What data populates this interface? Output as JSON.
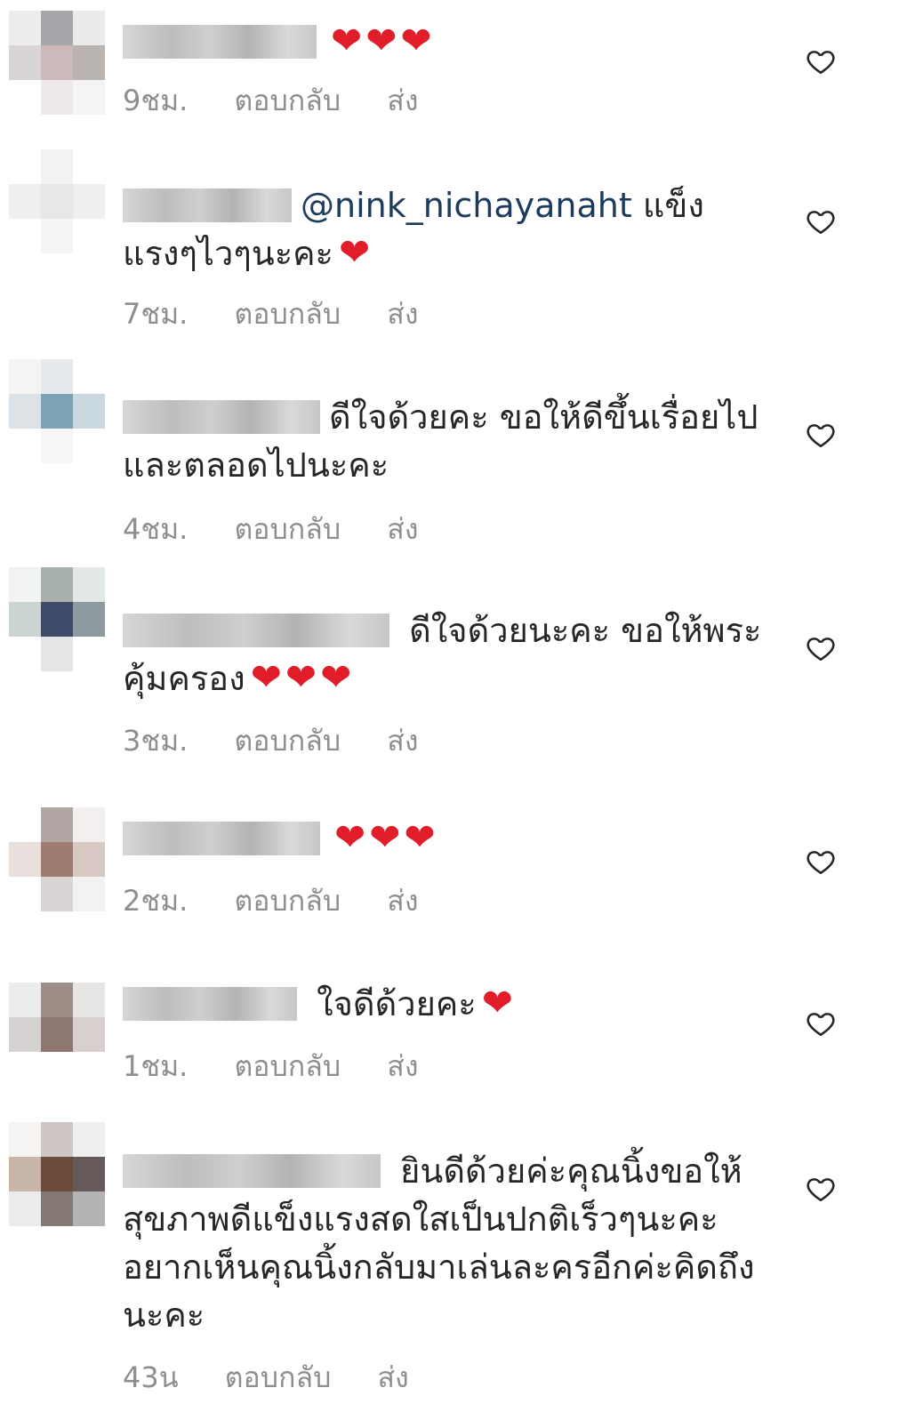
{
  "comments": [
    {
      "text": "",
      "hearts": "❤❤❤",
      "time": "9ชม.",
      "reply": "ตอบกลับ",
      "send": "ส่ง"
    },
    {
      "mention": "@nink_nichayanaht",
      "text": " แข็งแรงๆไวๆนะคะ",
      "hearts": "❤",
      "time": "7ชม.",
      "reply": "ตอบกลับ",
      "send": "ส่ง"
    },
    {
      "text": "ดีใจด้วยคะ ขอให้ดีขึ้นเรื่อยไปและตลอดไปนะคะ",
      "hearts": "",
      "time": "4ชม.",
      "reply": "ตอบกลับ",
      "send": "ส่ง"
    },
    {
      "text": " ดีใจด้วยนะคะ ขอให้พระคุ้มครอง",
      "hearts": "❤❤❤",
      "time": "3ชม.",
      "reply": "ตอบกลับ",
      "send": "ส่ง"
    },
    {
      "text": "",
      "hearts": "❤❤❤",
      "time": "2ชม.",
      "reply": "ตอบกลับ",
      "send": "ส่ง"
    },
    {
      "text": " ใจดีด้วยคะ",
      "hearts": "❤",
      "time": "1ชม.",
      "reply": "ตอบกลับ",
      "send": "ส่ง"
    },
    {
      "text": " ยินดีด้วยค่ะคุณนิ้งขอให้สุขภาพดีแข็งแรงสดใสเป็นปกติเร็วๆนะคะอยากเห็นคุณนิ้งกลับมาเล่นละครอีกค่ะคิดถึงนะคะ",
      "hearts": "",
      "time": "43น",
      "reply": "ตอบกลับ",
      "send": "ส่ง"
    }
  ],
  "colors": {
    "text": "#262626",
    "meta": "#8e8e8e",
    "mention": "#1e3a5c",
    "heart": "#e11d2a",
    "like_icon": "#262626"
  },
  "icons": {
    "like": "heart-outline-icon",
    "emoji": "red-heart-emoji"
  }
}
